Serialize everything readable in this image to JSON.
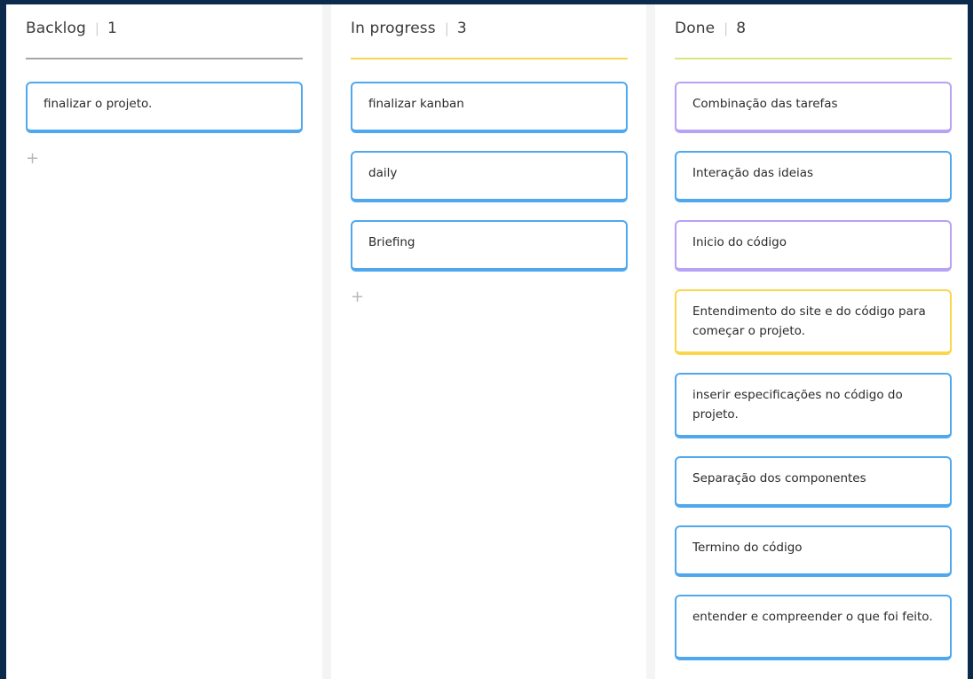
{
  "colors": {
    "background": "#0c2a4c",
    "card_blue": "#4fa8ee",
    "card_purple": "#b7a2f4",
    "card_yellow": "#fbd64a",
    "rule_backlog": "#a6a6a6",
    "rule_progress": "#fbd64a",
    "rule_done": "#d7e77b"
  },
  "columns": [
    {
      "title": "Backlog",
      "count": "1",
      "cards": [
        {
          "text": "finalizar o projeto.",
          "color": "blue"
        }
      ],
      "add_icon": "+"
    },
    {
      "title": "In progress",
      "count": "3",
      "cards": [
        {
          "text": "finalizar kanban",
          "color": "blue"
        },
        {
          "text": "daily",
          "color": "blue"
        },
        {
          "text": "Briefing",
          "color": "blue"
        }
      ],
      "add_icon": "+"
    },
    {
      "title": "Done",
      "count": "8",
      "cards": [
        {
          "text": "Combinação das tarefas",
          "color": "purple"
        },
        {
          "text": "Interação das ideias",
          "color": "blue"
        },
        {
          "text": "Inicio do código",
          "color": "purple"
        },
        {
          "text": "Entendimento do site e do código para começar o projeto.",
          "color": "yellow"
        },
        {
          "text": "inserir especificações no código do projeto.",
          "color": "blue"
        },
        {
          "text": "Separação dos componentes",
          "color": "blue"
        },
        {
          "text": "Termino do código",
          "color": "blue"
        },
        {
          "text": "entender e compreender o que foi feito.",
          "color": "blue"
        }
      ]
    }
  ]
}
